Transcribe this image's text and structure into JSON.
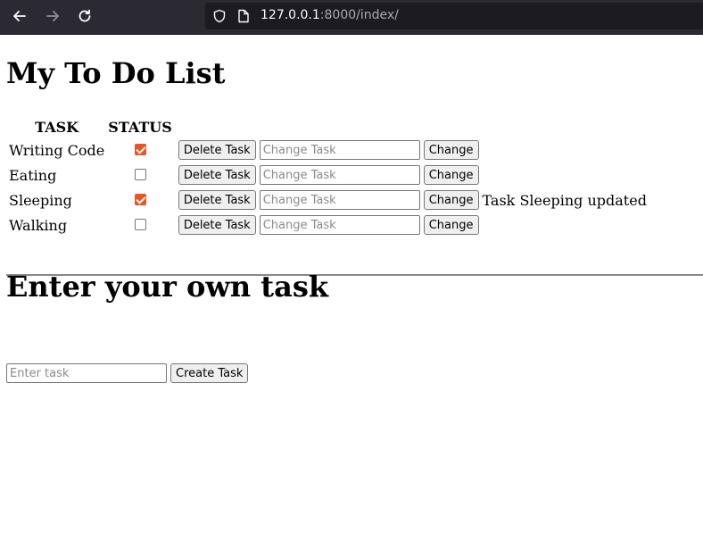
{
  "browser": {
    "url_host": "127.0.0.1",
    "url_rest": ":8000/index/"
  },
  "main": {
    "title": "My To Do List",
    "headers": {
      "task": "TASK",
      "status": "STATUS"
    },
    "delete_label": "Delete Task",
    "change_placeholder": "Change Task",
    "change_label": "Change",
    "tasks": [
      {
        "name": "Writing Code",
        "done": true,
        "message": ""
      },
      {
        "name": "Eating",
        "done": false,
        "message": ""
      },
      {
        "name": "Sleeping",
        "done": true,
        "message": "Task Sleeping updated"
      },
      {
        "name": "Walking",
        "done": false,
        "message": ""
      }
    ]
  },
  "create": {
    "title": "Enter your own task",
    "placeholder": "Enter task",
    "button_label": "Create Task"
  },
  "colors": {
    "checkbox_checked": "#e95420"
  }
}
